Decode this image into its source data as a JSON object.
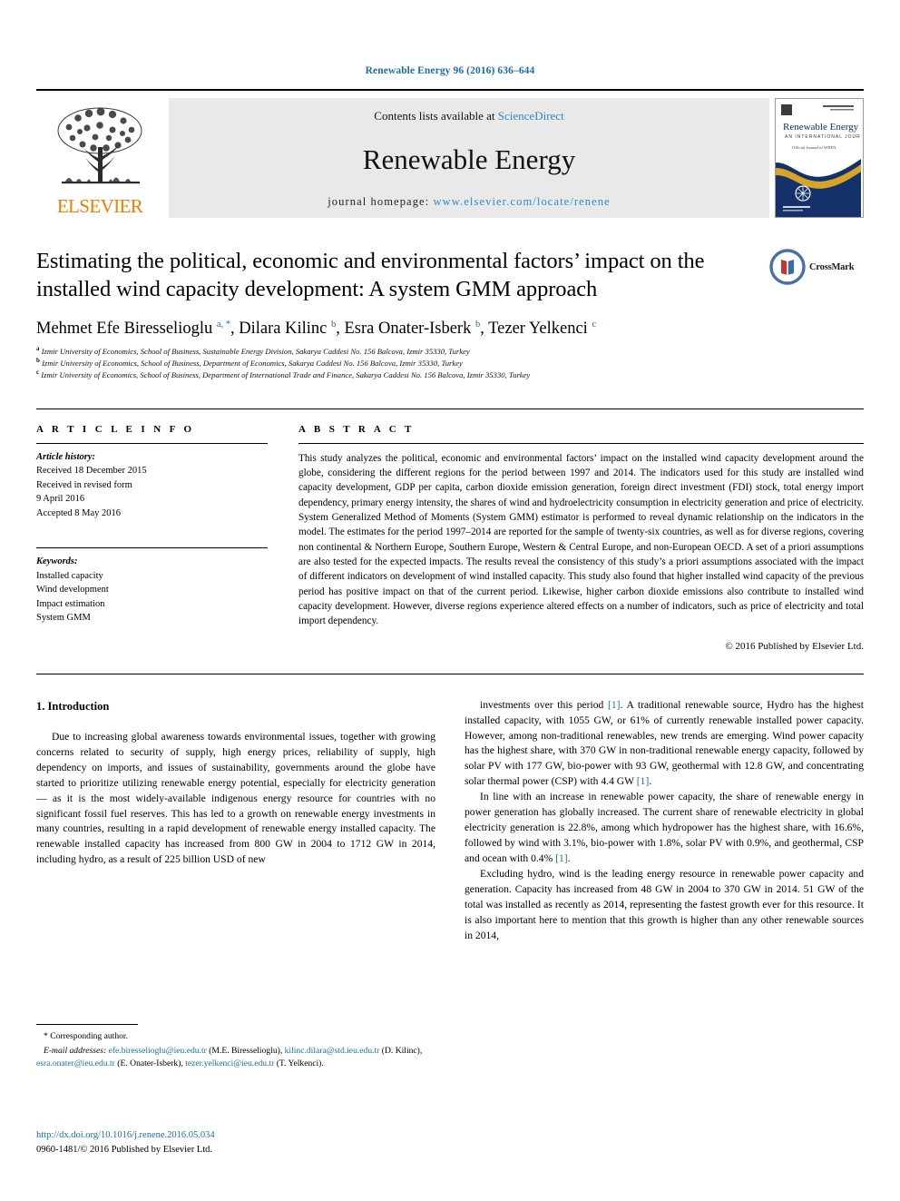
{
  "running_head": "Renewable Energy 96 (2016) 636–644",
  "banner": {
    "publisher_name": "ELSEVIER",
    "contents_prefix": "Contents lists available at ",
    "contents_link": "ScienceDirect",
    "journal_name": "Renewable Energy",
    "homepage_prefix": "journal homepage: ",
    "homepage_url": "www.elsevier.com/locate/renene",
    "cover_title": "Renewable Energy",
    "cover_subtitle": "AN INTERNATIONAL JOURNAL",
    "cover_note": "Official Journal of WREN"
  },
  "article": {
    "title": "Estimating the political, economic and environmental factors’ impact on the installed wind capacity development: A system GMM approach",
    "crossmark_label": "CrossMark",
    "authors_html": "Mehmet Efe Biresselioglu <sup>a, *</sup>, Dilara Kilinc <sup>b</sup>, Esra Onater-Isberk <sup>b</sup>, Tezer Yelkenci <sup>c</sup>",
    "affiliations": [
      {
        "marker": "a",
        "text": "Izmir University of Economics, School of Business, Sustainable Energy Division, Sakarya Caddesi No. 156 Balcova, Izmir 35330, Turkey"
      },
      {
        "marker": "b",
        "text": "Izmir University of Economics, School of Business, Department of Economics, Sakarya Caddesi No. 156 Balcova, Izmir 35330, Turkey"
      },
      {
        "marker": "c",
        "text": "Izmir University of Economics, School of Business, Department of International Trade and Finance, Sakarya Caddesi No. 156 Balcova, Izmir 35330, Turkey"
      }
    ]
  },
  "article_info": {
    "heading": "A R T I C L E   I N F O",
    "history_label": "Article history:",
    "history": [
      "Received 18 December 2015",
      "Received in revised form",
      "9 April 2016",
      "Accepted 8 May 2016"
    ],
    "keywords_label": "Keywords:",
    "keywords": [
      "Installed capacity",
      "Wind development",
      "Impact estimation",
      "System GMM"
    ]
  },
  "abstract": {
    "heading": "A B S T R A C T",
    "text": "This study analyzes the political, economic and environmental factors’ impact on the installed wind capacity development around the globe, considering the different regions for the period between 1997 and 2014. The indicators used for this study are installed wind capacity development, GDP per capita, carbon dioxide emission generation, foreign direct investment (FDI) stock, total energy import dependency, primary energy intensity, the shares of wind and hydroelectricity consumption in electricity generation and price of electricity. System Generalized Method of Moments (System GMM) estimator is performed to reveal dynamic relationship on the indicators in the model. The estimates for the period 1997–2014 are reported for the sample of twenty-six countries, as well as for diverse regions, covering non continental & Northern Europe, Southern Europe, Western & Central Europe, and non-European OECD. A set of a priori assumptions are also tested for the expected impacts. The results reveal the consistency of this study’s a priori assumptions associated with the impact of different indicators on development of wind installed capacity. This study also found that higher installed wind capacity of the previous period has positive impact on that of the current period. Likewise, higher carbon dioxide emissions also contribute to installed wind capacity development. However, diverse regions experience altered effects on a number of indicators, such as price of electricity and total import dependency.",
    "copyright": "© 2016 Published by Elsevier Ltd."
  },
  "introduction": {
    "section_number_title": "1. Introduction",
    "left_paragraph": "Due to increasing global awareness towards environmental issues, together with growing concerns related to security of supply, high energy prices, reliability of supply, high dependency on imports, and issues of sustainability, governments around the globe have started to prioritize utilizing renewable energy potential, especially for electricity generation — as it is the most widely-available indigenous energy resource for countries with no significant fossil fuel reserves. This has led to a growth on renewable energy investments in many countries, resulting in a rapid development of renewable energy installed capacity. The renewable installed capacity has increased from 800 GW in 2004 to 1712 GW in 2014, including hydro, as a result of 225 billion USD of new",
    "right_paragraph_1_a": "investments over this period ",
    "right_paragraph_1_ref": "[1]",
    "right_paragraph_1_b": ". A traditional renewable source, Hydro has the highest installed capacity, with 1055 GW, or 61% of currently renewable installed power capacity. However, among non-traditional renewables, new trends are emerging. Wind power capacity has the highest share, with 370 GW in non-traditional renewable energy capacity, followed by solar PV with 177 GW, bio-power with 93 GW, geothermal with 12.8 GW, and concentrating solar thermal power (CSP) with 4.4 GW ",
    "right_paragraph_1_ref2": "[1]",
    "right_paragraph_1_c": ".",
    "right_paragraph_2_a": "In line with an increase in renewable power capacity, the share of renewable energy in power generation has globally increased. The current share of renewable electricity in global electricity generation is 22.8%, among which hydropower has the highest share, with 16.6%, followed by wind with 3.1%, bio-power with 1.8%, solar PV with 0.9%, and geothermal, CSP and ocean with 0.4% ",
    "right_paragraph_2_ref": "[1]",
    "right_paragraph_2_b": ".",
    "right_paragraph_3": "Excluding hydro, wind is the leading energy resource in renewable power capacity and generation. Capacity has increased from 48 GW in 2004 to 370 GW in 2014. 51 GW of the total was installed as recently as 2014, representing the fastest growth ever for this resource. It is also important here to mention that this growth is higher than any other renewable sources in 2014,"
  },
  "footnotes": {
    "corresponding_author": "* Corresponding author.",
    "email_label": "E-mail addresses:",
    "emails": [
      {
        "address": "efe.biresselioglu@ieu.edu.tr",
        "person": "(M.E. Biresselioglu)"
      },
      {
        "address": "kilinc.dilara@std.ieu.edu.tr",
        "person": "(D. Kilinc)"
      },
      {
        "address": "esra.onater@ieu.edu.tr",
        "person": "(E. Onater-Isberk)"
      },
      {
        "address": "tezer.yelkenci@ieu.edu.tr",
        "person": "(T. Yelkenci)"
      }
    ],
    "doi": "http://dx.doi.org/10.1016/j.renene.2016.05.034",
    "issn_line": "0960-1481/© 2016 Published by Elsevier Ltd."
  },
  "colors": {
    "link_blue": "#1a6ea8",
    "science_direct_blue": "#2b8cc4",
    "elsevier_orange": "#f07d00"
  }
}
